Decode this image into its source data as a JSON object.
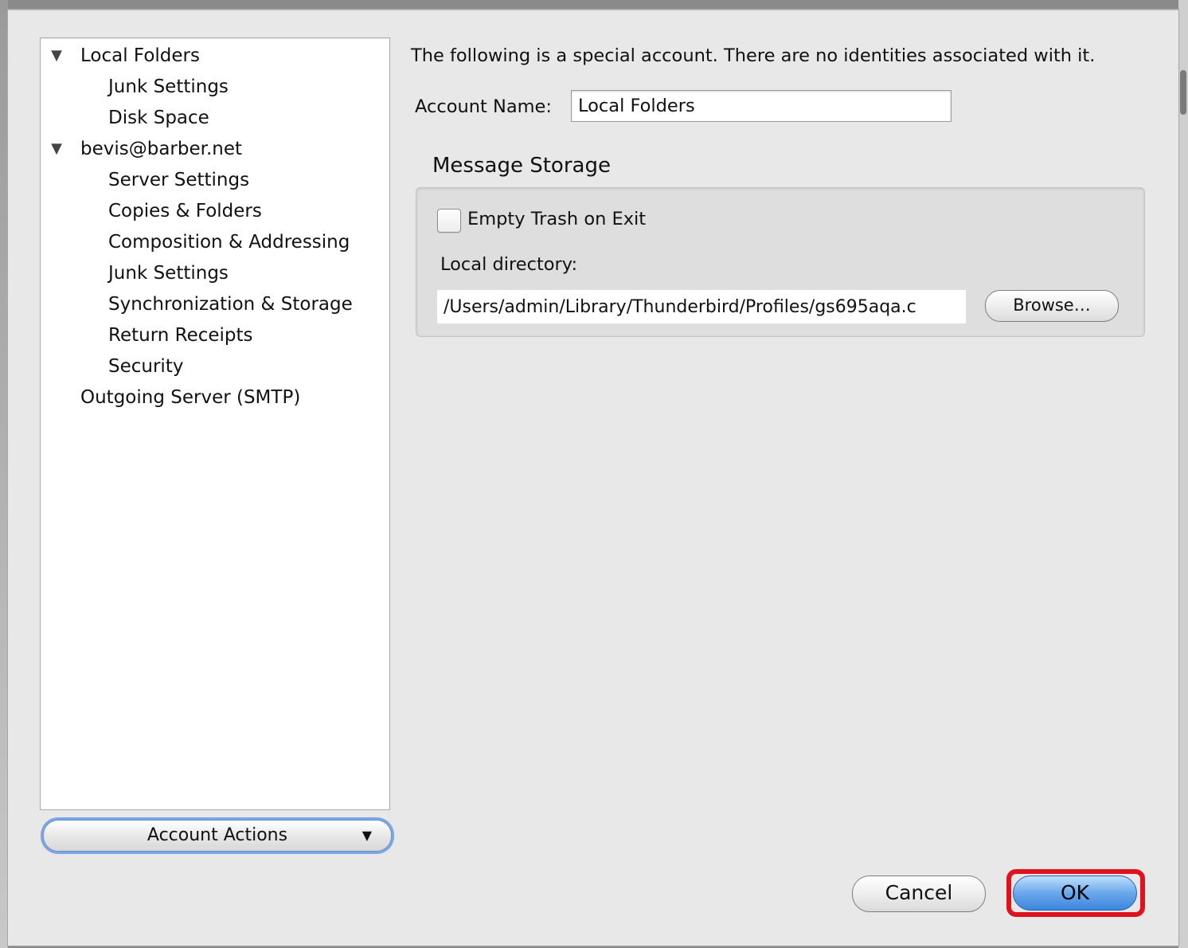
{
  "tree": {
    "items": [
      {
        "label": "Local Folders",
        "expanded": true
      },
      {
        "label": "Junk Settings"
      },
      {
        "label": "Disk Space"
      },
      {
        "label": "bevis@barber.net",
        "expanded": true
      },
      {
        "label": "Server Settings"
      },
      {
        "label": "Copies & Folders"
      },
      {
        "label": "Composition & Addressing"
      },
      {
        "label": "Junk Settings"
      },
      {
        "label": "Synchronization & Storage"
      },
      {
        "label": "Return Receipts"
      },
      {
        "label": "Security"
      },
      {
        "label": "Outgoing Server (SMTP)"
      }
    ],
    "disclosure_glyph": "▼"
  },
  "account_actions": {
    "label": "Account Actions",
    "caret": "▼"
  },
  "main": {
    "intro_text": "The following is a special account. There are no identities associated with it.",
    "account_name_label": "Account Name:",
    "account_name_value": "Local Folders",
    "message_storage": {
      "title": "Message Storage",
      "empty_trash_label": "Empty Trash on Exit",
      "empty_trash_checked": false,
      "local_dir_label": "Local directory:",
      "local_dir_value": "/Users/admin/Library/Thunderbird/Profiles/gs695aqa.c",
      "browse_label": "Browse…"
    }
  },
  "buttons": {
    "cancel_label": "Cancel",
    "ok_label": "OK"
  },
  "colors": {
    "ok_highlight": "#e0121e",
    "default_button": "#3c86de"
  }
}
